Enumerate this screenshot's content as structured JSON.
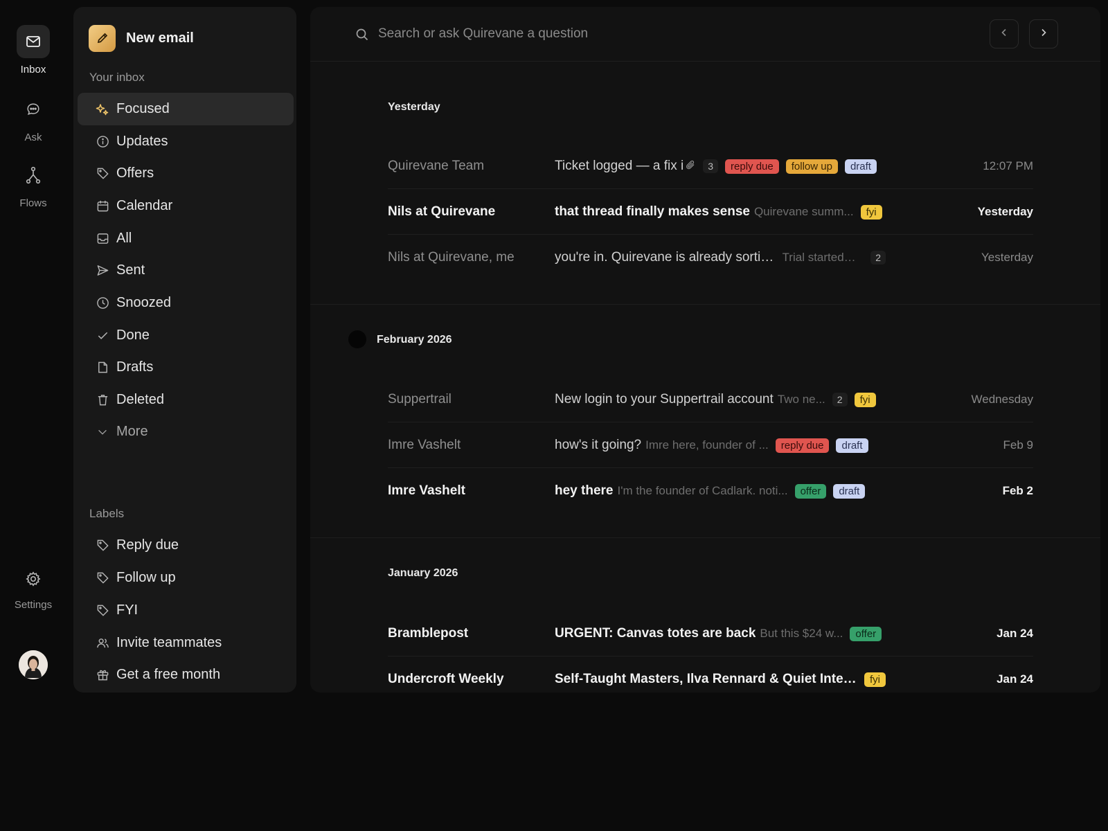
{
  "rail": {
    "inbox": "Inbox",
    "ask": "Ask",
    "flows": "Flows",
    "settings": "Settings"
  },
  "sidebar": {
    "new_email": "New email",
    "inbox_heading": "Your inbox",
    "items": [
      {
        "label": "Focused",
        "icon": "sparkle-icon"
      },
      {
        "label": "Updates",
        "icon": "info-icon"
      },
      {
        "label": "Offers",
        "icon": "tag-icon"
      },
      {
        "label": "Calendar",
        "icon": "calendar-icon"
      },
      {
        "label": "All",
        "icon": "tray-icon"
      },
      {
        "label": "Sent",
        "icon": "send-icon"
      },
      {
        "label": "Snoozed",
        "icon": "clock-icon"
      },
      {
        "label": "Done",
        "icon": "check-icon"
      },
      {
        "label": "Drafts",
        "icon": "file-icon"
      },
      {
        "label": "Deleted",
        "icon": "trash-icon"
      },
      {
        "label": "More",
        "icon": "chevron-down-icon"
      }
    ],
    "labels_heading": "Labels",
    "labels": [
      {
        "label": "Reply due",
        "icon": "tag-icon"
      },
      {
        "label": "Follow up",
        "icon": "tag-icon"
      },
      {
        "label": "FYI",
        "icon": "tag-icon"
      },
      {
        "label": "Invite teammates",
        "icon": "users-icon"
      },
      {
        "label": "Get a free month",
        "icon": "gift-icon"
      }
    ]
  },
  "search": {
    "placeholder": "Search or ask Quirevane a question"
  },
  "groups": [
    {
      "title": "Yesterday",
      "rows": [
        {
          "sender": "Quirevane Team",
          "subject": "Ticket logged — a fix i",
          "snippet": "",
          "attachment": true,
          "count": "3",
          "tags": [
            "reply due",
            "follow up",
            "draft"
          ],
          "date": "12:07 PM",
          "unread": false
        },
        {
          "sender": "Nils at Quirevane",
          "subject": "that thread finally makes sense",
          "snippet": "Quirevane summ...",
          "attachment": false,
          "count": "",
          "tags": [
            "fyi"
          ],
          "date": "Yesterday",
          "unread": true
        },
        {
          "sender": "Nils at Quirevane, me",
          "subject": "you're in. Quirevane is already sorting.",
          "snippet": "Trial started;...",
          "attachment": false,
          "count": "2",
          "tags": [],
          "date": "Yesterday",
          "unread": false
        }
      ]
    },
    {
      "title": "February 2026",
      "rows": [
        {
          "sender": "Suppertrail",
          "subject": "New login to your Suppertrail account",
          "snippet": "Two ne...",
          "attachment": false,
          "count": "2",
          "tags": [
            "fyi"
          ],
          "date": "Wednesday",
          "unread": false
        },
        {
          "sender": "Imre Vashelt",
          "subject": "how's it going?",
          "snippet": "Imre here, founder of ...",
          "attachment": false,
          "count": "",
          "tags": [
            "reply due",
            "draft"
          ],
          "date": "Feb 9",
          "unread": false
        },
        {
          "sender": "Imre Vashelt",
          "subject": "hey there",
          "snippet": "I'm the founder of Cadlark. noti...",
          "attachment": false,
          "count": "",
          "tags": [
            "offer",
            "draft"
          ],
          "date": "Feb 2",
          "unread": true
        }
      ]
    },
    {
      "title": "January 2026",
      "rows": [
        {
          "sender": "Bramblepost",
          "subject": "URGENT: Canvas totes are back",
          "snippet": "But this $24 w...",
          "attachment": false,
          "count": "",
          "tags": [
            "offer"
          ],
          "date": "Jan 24",
          "unread": true
        },
        {
          "sender": "Undercroft Weekly",
          "subject": "Self-Taught Masters, Ilva Rennard & Quiet Interiors",
          "snippet": "",
          "attachment": false,
          "count": "",
          "tags": [
            "fyi"
          ],
          "date": "Jan 24",
          "unread": true
        }
      ]
    }
  ],
  "tag_colors": {
    "reply due": "#e0554f",
    "follow up": "#e5a83a",
    "draft": "#c9d3f2",
    "fyi": "#f0c73d",
    "offer": "#36a06a"
  }
}
